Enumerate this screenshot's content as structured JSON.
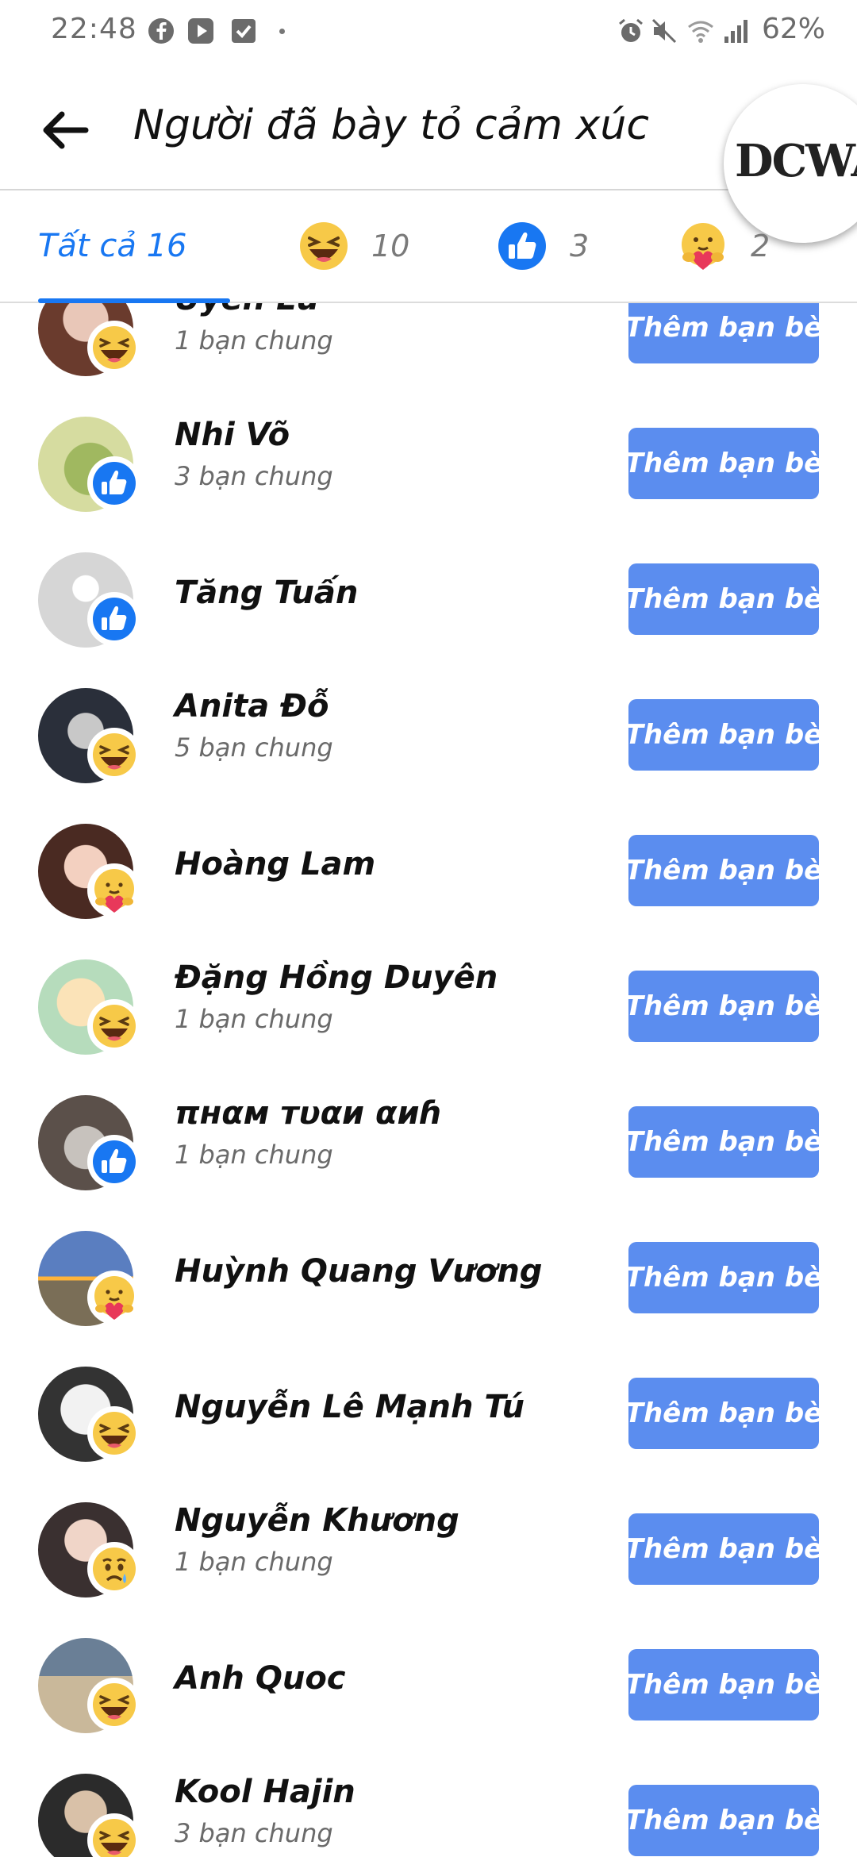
{
  "status_bar": {
    "time": "22:48",
    "battery": "62%",
    "icons": [
      "facebook-icon",
      "youtube-icon",
      "check-icon",
      "alarm-icon",
      "mute-icon",
      "wifi-icon",
      "signal-icon"
    ]
  },
  "header": {
    "title": "Người đã bày tỏ cảm xúc",
    "logo_text": "DCWAC"
  },
  "tabs": [
    {
      "label": "Tất cả 16",
      "active": true
    },
    {
      "reaction": "haha",
      "count": "10"
    },
    {
      "reaction": "like",
      "count": "3"
    },
    {
      "reaction": "care",
      "count": "2"
    }
  ],
  "people": [
    {
      "name": "Uyên Lư",
      "mutual": "1 bạn chung",
      "reaction": "haha",
      "button": "Thêm bạn bè"
    },
    {
      "name": "Nhi Võ",
      "mutual": "3 bạn chung",
      "reaction": "like",
      "button": "Thêm bạn bè"
    },
    {
      "name": "Tăng Tuấn",
      "mutual": "",
      "reaction": "like",
      "button": "Thêm bạn bè"
    },
    {
      "name": "Anita Đỗ",
      "mutual": "5 bạn chung",
      "reaction": "haha",
      "button": "Thêm bạn bè"
    },
    {
      "name": "Hoàng Lam",
      "mutual": "",
      "reaction": "care",
      "button": "Thêm bạn bè"
    },
    {
      "name": "Đặng Hồng Duyên",
      "mutual": "1 bạn chung",
      "reaction": "haha",
      "button": "Thêm bạn bè"
    },
    {
      "name": "πнαм тυαи αиɦ",
      "mutual": "1 bạn chung",
      "reaction": "like",
      "button": "Thêm bạn bè"
    },
    {
      "name": "Huỳnh Quang Vương",
      "mutual": "",
      "reaction": "care",
      "button": "Thêm bạn bè"
    },
    {
      "name": "Nguyễn Lê Mạnh Tú",
      "mutual": "",
      "reaction": "haha",
      "button": "Thêm bạn bè"
    },
    {
      "name": "Nguyễn Khương",
      "mutual": "1 bạn chung",
      "reaction": "sad",
      "button": "Thêm bạn bè"
    },
    {
      "name": "Anh Quoc",
      "mutual": "",
      "reaction": "haha",
      "button": "Thêm bạn bè"
    },
    {
      "name": "Kool Hajin",
      "mutual": "3 bạn chung",
      "reaction": "haha",
      "button": "Thêm bạn bè"
    }
  ],
  "colors": {
    "accent": "#1877f2",
    "button": "#5b8def",
    "haha": "#f7c948",
    "like": "#1877f2"
  }
}
